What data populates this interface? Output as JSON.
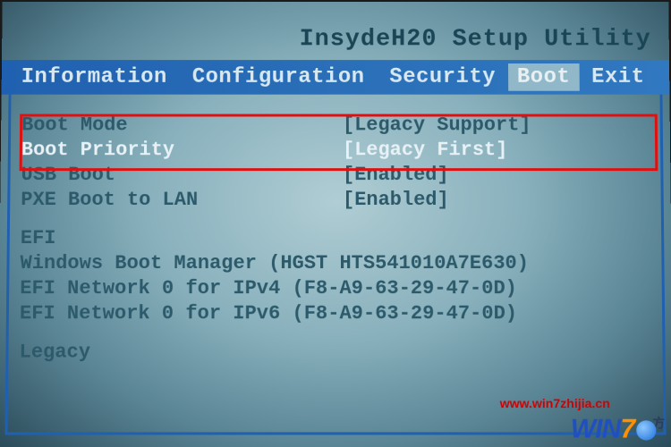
{
  "title": "InsydeH20 Setup Utility",
  "menu": {
    "items": [
      "Information",
      "Configuration",
      "Security",
      "Boot",
      "Exit"
    ],
    "active_index": 3
  },
  "settings": [
    {
      "label": "Boot Mode",
      "value": "[Legacy Support]",
      "selected": false
    },
    {
      "label": "Boot Priority",
      "value": "[Legacy First]",
      "selected": true
    },
    {
      "label": "USB Boot",
      "value": "[Enabled]",
      "selected": false
    },
    {
      "label": "PXE Boot to LAN",
      "value": "[Enabled]",
      "selected": false
    }
  ],
  "sections": [
    {
      "header": "EFI",
      "entries": [
        "Windows Boot Manager (HGST HTS541010A7E630)",
        "EFI Network 0 for IPv4 (F8-A9-63-29-47-0D)",
        "EFI Network 0 for IPv6 (F8-A9-63-29-47-0D)"
      ]
    },
    {
      "header": "Legacy",
      "entries": []
    }
  ],
  "watermark": "www.win7zhijia.cn",
  "logo": {
    "w": "W",
    "i": "I",
    "n": "N",
    "seven": "7",
    "suffix": "方"
  },
  "highlight_rows": [
    0,
    1
  ]
}
